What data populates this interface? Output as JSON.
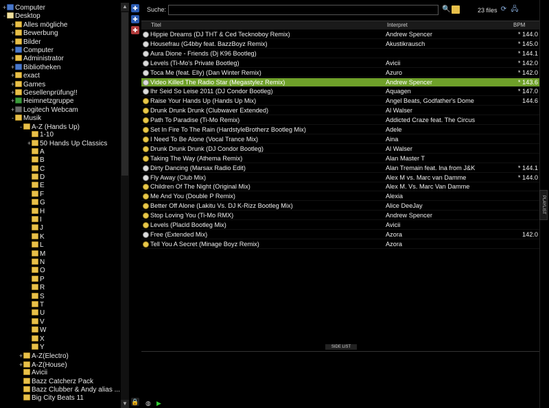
{
  "tree": [
    {
      "label": "Computer",
      "exp": "+",
      "icon": "comp",
      "indent": 0
    },
    {
      "label": "Desktop",
      "exp": "-",
      "icon": "plain",
      "indent": 0
    },
    {
      "label": "Alles mögliche",
      "exp": "+",
      "icon": "folder",
      "indent": 1
    },
    {
      "label": "Bewerbung",
      "exp": "+",
      "icon": "folder",
      "indent": 1
    },
    {
      "label": "Bilder",
      "exp": "+",
      "icon": "folder",
      "indent": 1
    },
    {
      "label": "Computer",
      "exp": "+",
      "icon": "comp",
      "indent": 1
    },
    {
      "label": "Administrator",
      "exp": "+",
      "icon": "folder",
      "indent": 1
    },
    {
      "label": "Bibliotheken",
      "exp": "+",
      "icon": "comp",
      "indent": 1
    },
    {
      "label": "exact",
      "exp": "+",
      "icon": "folder",
      "indent": 1
    },
    {
      "label": "Games",
      "exp": "+",
      "icon": "folder",
      "indent": 1
    },
    {
      "label": "Gesellenprüfung!!",
      "exp": "+",
      "icon": "folder",
      "indent": 1
    },
    {
      "label": "Heimnetzgruppe",
      "exp": "+",
      "icon": "net",
      "indent": 1
    },
    {
      "label": "Logitech Webcam",
      "exp": "+",
      "icon": "cam",
      "indent": 1
    },
    {
      "label": "Musik",
      "exp": "-",
      "icon": "folder",
      "indent": 1
    },
    {
      "label": "A-Z (Hands Up)",
      "exp": "-",
      "icon": "folder",
      "indent": 2
    },
    {
      "label": "1-10",
      "exp": "",
      "icon": "folder",
      "indent": 3
    },
    {
      "label": "50 Hands Up Classics",
      "exp": "+",
      "icon": "folder",
      "indent": 3
    },
    {
      "label": "A",
      "exp": "",
      "icon": "folder",
      "indent": 3
    },
    {
      "label": "B",
      "exp": "",
      "icon": "folder",
      "indent": 3
    },
    {
      "label": "C",
      "exp": "",
      "icon": "folder",
      "indent": 3
    },
    {
      "label": "D",
      "exp": "",
      "icon": "folder",
      "indent": 3
    },
    {
      "label": "E",
      "exp": "",
      "icon": "folder",
      "indent": 3
    },
    {
      "label": "F",
      "exp": "",
      "icon": "folder",
      "indent": 3
    },
    {
      "label": "G",
      "exp": "",
      "icon": "folder",
      "indent": 3
    },
    {
      "label": "H",
      "exp": "",
      "icon": "folder",
      "indent": 3
    },
    {
      "label": "I",
      "exp": "",
      "icon": "folder",
      "indent": 3
    },
    {
      "label": "J",
      "exp": "",
      "icon": "folder",
      "indent": 3
    },
    {
      "label": "K",
      "exp": "",
      "icon": "folder",
      "indent": 3
    },
    {
      "label": "L",
      "exp": "",
      "icon": "folder",
      "indent": 3
    },
    {
      "label": "M",
      "exp": "",
      "icon": "folder",
      "indent": 3
    },
    {
      "label": "N",
      "exp": "",
      "icon": "folder",
      "indent": 3
    },
    {
      "label": "O",
      "exp": "",
      "icon": "folder",
      "indent": 3
    },
    {
      "label": "P",
      "exp": "",
      "icon": "folder",
      "indent": 3
    },
    {
      "label": "R",
      "exp": "",
      "icon": "folder",
      "indent": 3
    },
    {
      "label": "S",
      "exp": "",
      "icon": "folder",
      "indent": 3
    },
    {
      "label": "T",
      "exp": "",
      "icon": "folder",
      "indent": 3
    },
    {
      "label": "U",
      "exp": "",
      "icon": "folder",
      "indent": 3
    },
    {
      "label": "V",
      "exp": "",
      "icon": "folder",
      "indent": 3
    },
    {
      "label": "W",
      "exp": "",
      "icon": "folder",
      "indent": 3
    },
    {
      "label": "X",
      "exp": "",
      "icon": "folder",
      "indent": 3
    },
    {
      "label": "Y",
      "exp": "",
      "icon": "folder",
      "indent": 3
    },
    {
      "label": "A-Z(Electro)",
      "exp": "+",
      "icon": "folder",
      "indent": 2
    },
    {
      "label": "A-Z(House)",
      "exp": "+",
      "icon": "folder",
      "indent": 2
    },
    {
      "label": "Avicii",
      "exp": "",
      "icon": "folder",
      "indent": 2
    },
    {
      "label": "Bazz Catcherz Pack",
      "exp": "",
      "icon": "folder",
      "indent": 2
    },
    {
      "label": "Bazz Clubber & Andy alias ...",
      "exp": "",
      "icon": "folder",
      "indent": 2
    },
    {
      "label": "Big City Beats 11",
      "exp": "",
      "icon": "folder",
      "indent": 2
    }
  ],
  "search": {
    "label": "Suche:",
    "value": "",
    "files_count": "23 files"
  },
  "grid": {
    "headers": {
      "title": "Titel",
      "artist": "Interpret",
      "bpm": "BPM"
    },
    "rows": [
      {
        "title": "Hippie Dreams (DJ THT & Ced Tecknoboy Remix)",
        "artist": "Andrew Spencer",
        "bpm": "* 144.0",
        "icon": "w"
      },
      {
        "title": "Housefrau (G4bby feat. BazzBoyz Remix)",
        "artist": "Akustikrausch",
        "bpm": "* 145.0",
        "icon": "w"
      },
      {
        "title": "Aura Dione - Friends (Dj K96 Bootleg)",
        "artist": "",
        "bpm": "* 144.1",
        "icon": "w"
      },
      {
        "title": "Levels (Ti-Mo's Private Bootleg)",
        "artist": "Avicii",
        "bpm": "* 142.0",
        "icon": "w"
      },
      {
        "title": "Toca Me (feat. Elly) (Dan Winter Remix)",
        "artist": "Azuro",
        "bpm": "* 142.0",
        "icon": "w"
      },
      {
        "title": "Video Killed The Radio Star (Megastylez Remix)",
        "artist": "Andrew Spencer",
        "bpm": "* 143.6",
        "icon": "w",
        "selected": true
      },
      {
        "title": "Ihr Seid So Leise 2011 (DJ Condor Bootleg)",
        "artist": "Aquagen",
        "bpm": "* 147.0",
        "icon": "w"
      },
      {
        "title": "Raise Your Hands Up (Hands Up Mix)",
        "artist": "Angel Beats, Godfather's Dome",
        "bpm": "144.6",
        "icon": "y"
      },
      {
        "title": "Drunk Drunk Drunk (Clubwaver Extended)",
        "artist": "Al Walser",
        "bpm": "",
        "icon": "y"
      },
      {
        "title": "Path To Paradise (Ti-Mo Remix)",
        "artist": "Addicted Craze feat. The Circus",
        "bpm": "",
        "icon": "y"
      },
      {
        "title": "Set In Fire To The Rain (HardstyleBrotherz Bootleg Mix)",
        "artist": "Adele",
        "bpm": "",
        "icon": "y"
      },
      {
        "title": "I Need To Be Alone (Vocal Trance Mix)",
        "artist": "Aina",
        "bpm": "",
        "icon": "y"
      },
      {
        "title": "Drunk Drunk Drunk (DJ Condor Bootleg)",
        "artist": "Al Walser",
        "bpm": "",
        "icon": "y"
      },
      {
        "title": "Taking The Way (Athema Remix)",
        "artist": "Alan Master T",
        "bpm": "",
        "icon": "y"
      },
      {
        "title": "Dirty Dancing (Marsax Radio Edit)",
        "artist": "Alan Tremain feat. Ina from J&K",
        "bpm": "* 144.1",
        "icon": "w"
      },
      {
        "title": "Fly Away (Club Mix)",
        "artist": "Alex M vs. Marc van Damme",
        "bpm": "* 144.0",
        "icon": "w"
      },
      {
        "title": "Children Of The Night (Original Mix)",
        "artist": "Alex M. Vs. Marc Van Damme",
        "bpm": "",
        "icon": "y"
      },
      {
        "title": "Me And You (Double P Remix)",
        "artist": "Alexia",
        "bpm": "",
        "icon": "y"
      },
      {
        "title": "Better Off Alone (Lakitu Vs. DJ K-Rizz Bootleg Mix)",
        "artist": "Alice DeeJay",
        "bpm": "",
        "icon": "y"
      },
      {
        "title": "Stop Loving You (Ti-Mo RMX)",
        "artist": "Andrew Spencer",
        "bpm": "",
        "icon": "y"
      },
      {
        "title": "Levels (Placld Bootleg Mix)",
        "artist": "Avicii",
        "bpm": "",
        "icon": "y"
      },
      {
        "title": "Free (Extended Mix)",
        "artist": "Azora",
        "bpm": "142.0",
        "icon": "w"
      },
      {
        "title": "Tell You A Secret (Minage Boyz Remix)",
        "artist": "Azora",
        "bpm": "",
        "icon": "y"
      }
    ]
  },
  "side_list_label": "SIDE LIST",
  "playlist_tab": "PLAYLIST",
  "colors": {
    "selected_row": "#6fa02a",
    "background": "#000000"
  }
}
